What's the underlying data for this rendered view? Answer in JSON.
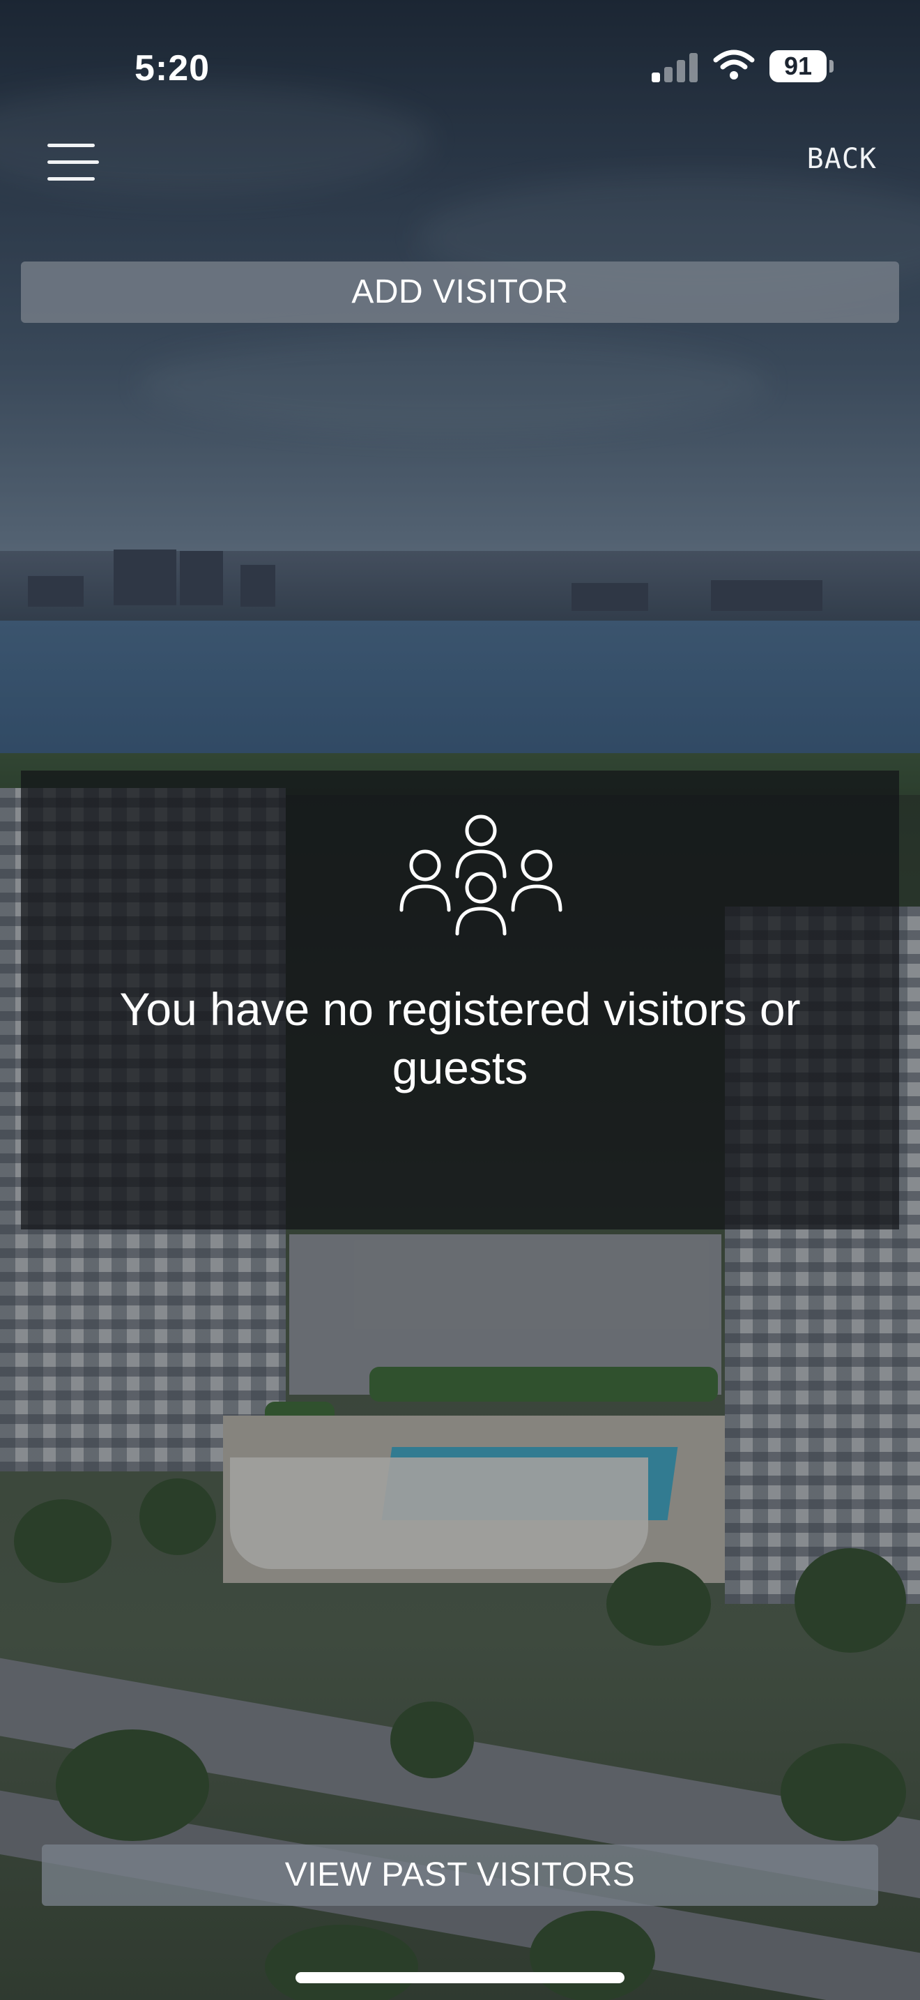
{
  "status_bar": {
    "time": "5:20",
    "battery": "91"
  },
  "header": {
    "menu_icon": "hamburger-menu-icon",
    "back_label": "BACK"
  },
  "actions": {
    "add_visitor_label": "ADD VISITOR",
    "view_past_label": "VIEW PAST VISITORS"
  },
  "empty_state": {
    "icon": "group-people-icon",
    "message": "You have no registered visitors or guests"
  },
  "colors": {
    "text": "#ffffff",
    "button_bg": "#787f8a",
    "panel_bg": "#121418"
  }
}
